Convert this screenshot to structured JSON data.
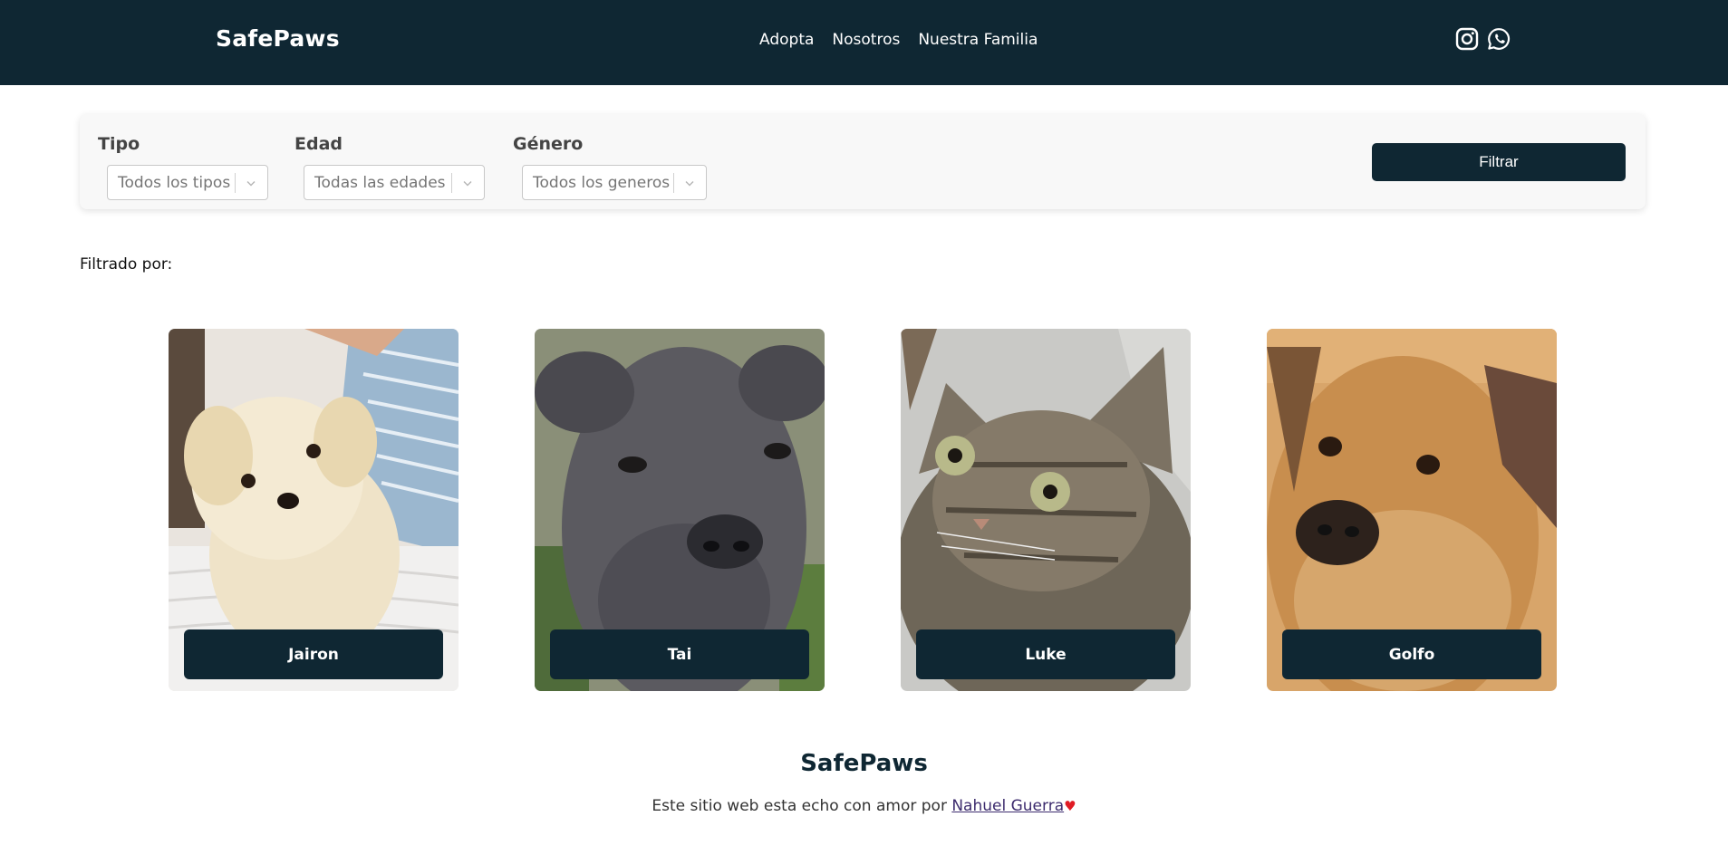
{
  "brand": "SafePaws",
  "nav": {
    "links": [
      "Adopta",
      "Nosotros",
      "Nuestra Familia"
    ]
  },
  "social": {
    "icons": [
      "instagram-icon",
      "whatsapp-icon"
    ]
  },
  "filters": {
    "tipo": {
      "label": "Tipo",
      "value": "Todos los tipos"
    },
    "edad": {
      "label": "Edad",
      "value": "Todas las edades"
    },
    "genero": {
      "label": "Género",
      "value": "Todos los generos"
    },
    "button": "Filtrar"
  },
  "filtered_by_label": "Filtrado por:",
  "pets": [
    {
      "name": "Jairon"
    },
    {
      "name": "Tai"
    },
    {
      "name": "Luke"
    },
    {
      "name": "Golfo"
    }
  ],
  "footer": {
    "title": "SafePaws",
    "text": "Este sitio web esta echo con amor por ",
    "author": "Nahuel Guerra",
    "heart": "♥"
  },
  "colors": {
    "primary": "#0f2733",
    "heart": "#e01b24"
  }
}
